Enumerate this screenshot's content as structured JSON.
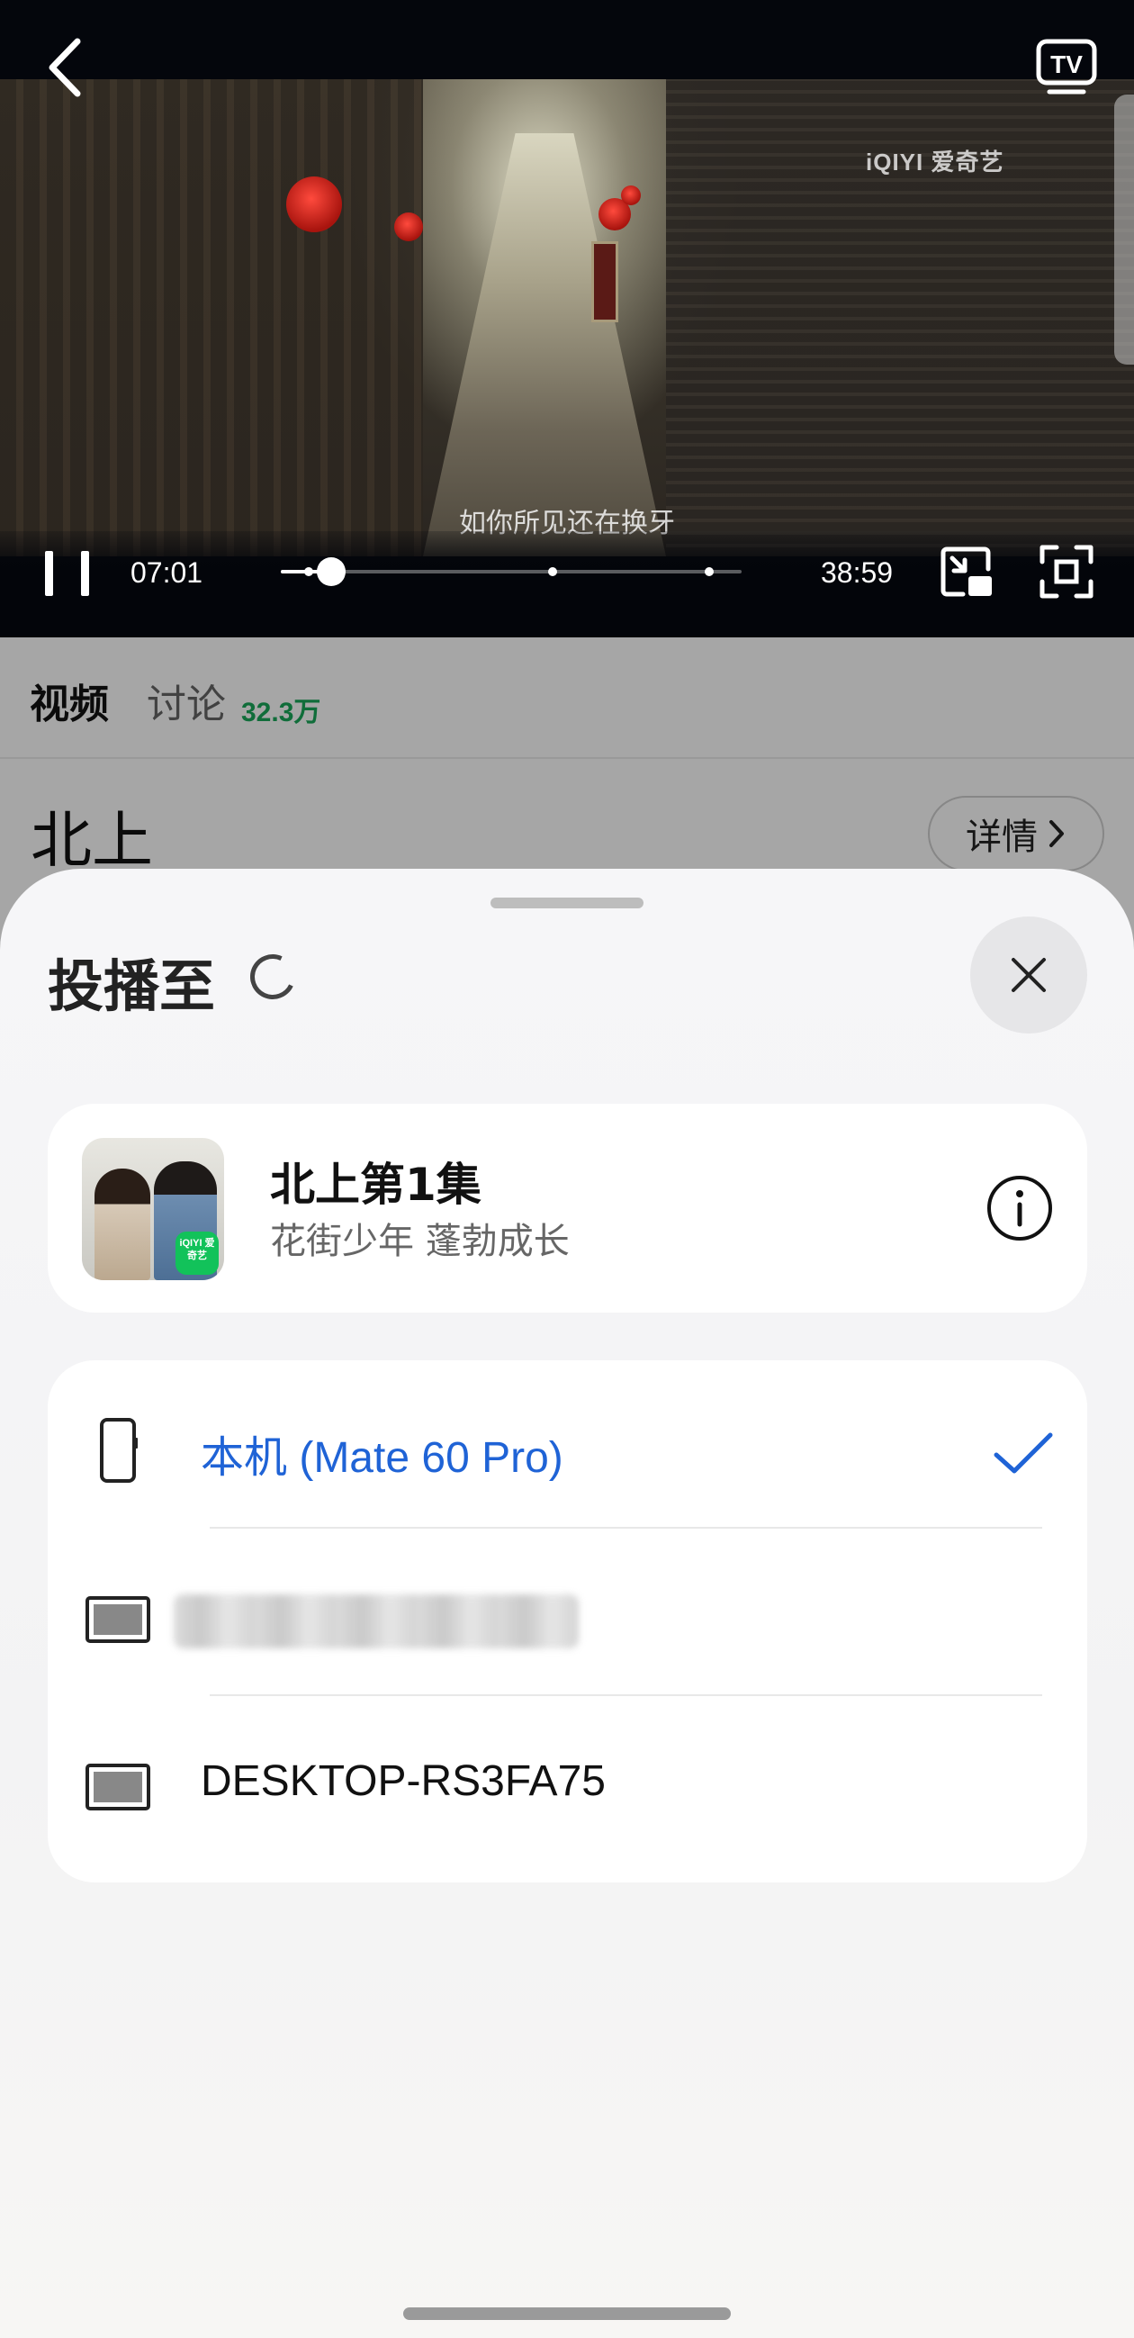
{
  "player": {
    "watermark": "iQIYI 爱奇艺",
    "subtitle": "如你所见还在换牙",
    "current_time": "07:01",
    "duration": "38:59",
    "progress": 0.11,
    "icons": {
      "back": "chevron-left-icon",
      "tv": "tv-cast-icon",
      "pause": "pause-icon",
      "pip": "picture-in-picture-icon",
      "fullscreen": "fullscreen-icon"
    }
  },
  "page": {
    "tabs": [
      {
        "label": "视频"
      },
      {
        "label": "讨论",
        "count": "32.3万"
      }
    ],
    "show_title": "北上",
    "detail_label": "详情"
  },
  "sheet": {
    "title": "投播至",
    "media": {
      "title": "北上第1集",
      "subtitle": "花街少年 蓬勃成长",
      "thumb_badge": "iQIYI 爱奇艺"
    },
    "devices": [
      {
        "name": "本机 (Mate 60 Pro)",
        "icon": "phone-icon",
        "selected": true
      },
      {
        "name": "",
        "icon": "monitor-icon",
        "selected": false
      },
      {
        "name": "DESKTOP-RS3FA75",
        "icon": "monitor-icon",
        "selected": false
      }
    ]
  },
  "colors": {
    "accent_blue": "#1f63d6",
    "count_green": "#1aa85a",
    "sheet_bg": "#f4f4f6"
  }
}
